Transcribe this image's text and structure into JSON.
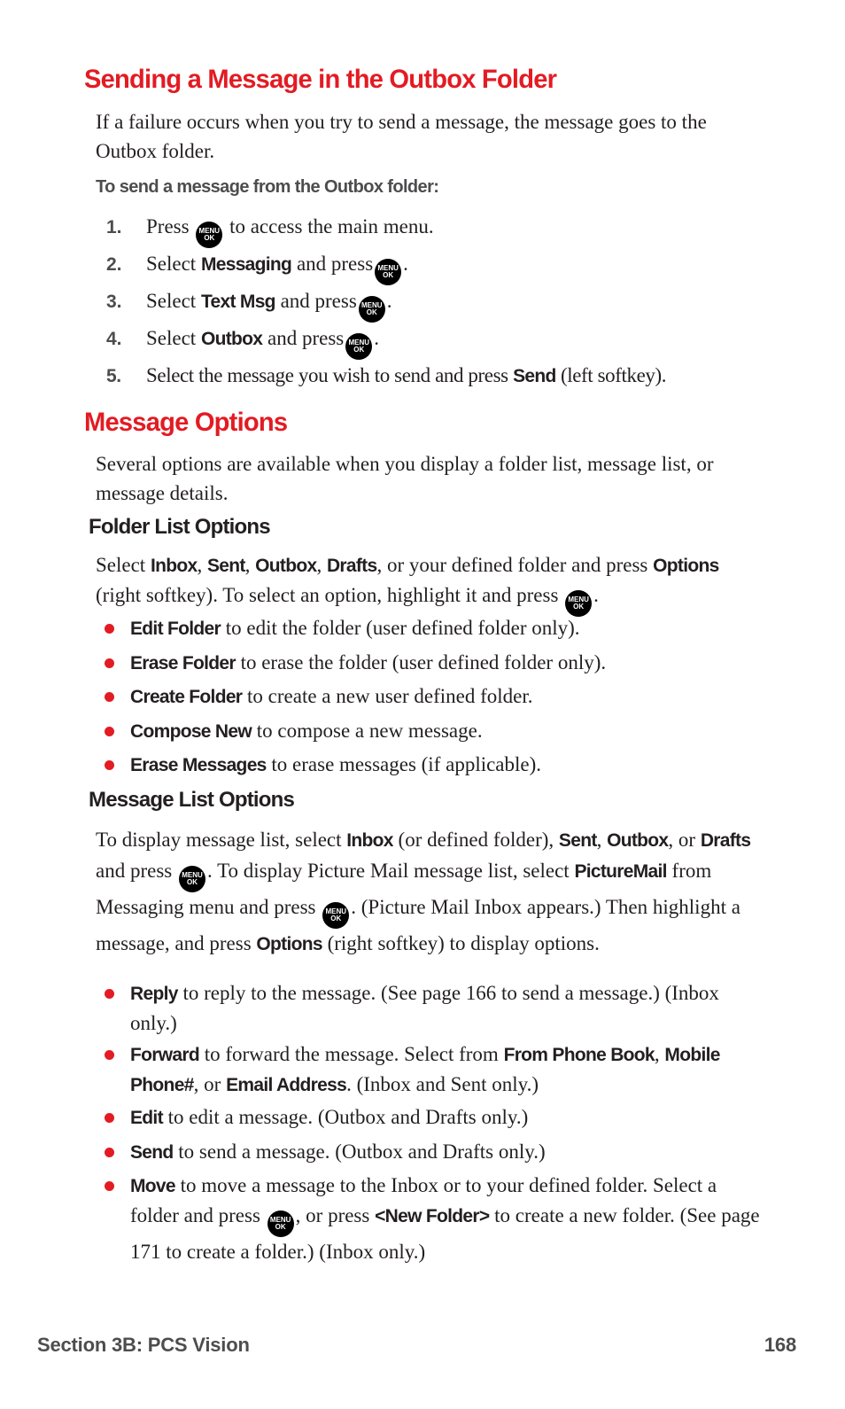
{
  "section1": {
    "title": "Sending a Message in the Outbox Folder",
    "intro": "If a failure occurs when you try to send a message, the message goes to the Outbox folder.",
    "subheading": "To send a message from the Outbox folder:",
    "steps": [
      {
        "num": "1.",
        "pre": "Press",
        "bold": "",
        "post": "to access the main menu."
      },
      {
        "num": "2.",
        "pre": "Select",
        "bold": "Messaging",
        "post": "and press"
      },
      {
        "num": "3.",
        "pre": "Select",
        "bold": "Text Msg",
        "post": "and press"
      },
      {
        "num": "4.",
        "pre": "Select",
        "bold": "Outbox",
        "post": "and press"
      },
      {
        "num": "5.",
        "pre": "Select the message you wish to send and press",
        "bold": "Send",
        "post": "(left softkey)."
      }
    ]
  },
  "menu_key": {
    "icon": "menu-ok-key-icon",
    "line1": "MENU",
    "line2": "OK"
  },
  "section2": {
    "title": "Message Options",
    "intro": "Several options are available when you display a folder list, message list, or message details.",
    "folder_list": {
      "heading": "Folder List Options",
      "intro": {
        "t1": "Select ",
        "b1": "Inbox",
        "t2": ", ",
        "b2": "Sent",
        "t3": ", ",
        "b3": "Outbox",
        "t4": ", ",
        "b4": "Drafts",
        "t5": ", or your defined folder and press ",
        "b5": "Options",
        "t6": " (right softkey). To select an option, highlight it and press ",
        "t7": "."
      },
      "items": [
        {
          "bold": "Edit Folder",
          "text": " to edit the folder (user defined folder only)."
        },
        {
          "bold": "Erase Folder",
          "text": " to erase the folder (user defined folder only)."
        },
        {
          "bold": "Create Folder",
          "text": " to create a new user defined folder."
        },
        {
          "bold": "Compose New",
          "text": " to compose a new message."
        },
        {
          "bold": "Erase Messages",
          "text": " to erase messages (if applicable)."
        }
      ]
    },
    "message_list": {
      "heading": "Message List Options",
      "intro": {
        "t1": "To display message list, select ",
        "b1": "Inbox",
        "t2": " (or defined folder), ",
        "b2": "Sent",
        "t3": ", ",
        "b3": "Outbox",
        "t4": ", or ",
        "b4": "Drafts",
        "t5": " and press ",
        "t6": ". To display Picture Mail message list, select ",
        "b5": "PictureMail",
        "t7": " from Messaging menu and press ",
        "t8": ". (Picture Mail Inbox appears.) Then highlight a message, and press ",
        "b6": "Options",
        "t9": " (right softkey) to display options."
      },
      "items": {
        "reply": {
          "bold": "Reply",
          "text": " to reply to the message. (See page 166 to send a message.) (Inbox only.)"
        },
        "forward": {
          "bold": "Forward",
          "t1": " to forward the message. Select from ",
          "b1": "From Phone Book",
          "t2": ", ",
          "b2": "Mobile Phone#",
          "t3": ", or ",
          "b3": "Email Address",
          "t4": ". (Inbox and Sent only.)"
        },
        "edit": {
          "bold": "Edit",
          "text": " to edit a message. (Outbox and Drafts only.)"
        },
        "send": {
          "bold": "Send",
          "text": " to send a message. (Outbox and Drafts only.)"
        },
        "move": {
          "bold": "Move",
          "t1": " to move a message to the Inbox or to your defined folder. Select a folder and press ",
          "t2": ", or press ",
          "b1": "<New Folder>",
          "t3": " to create a new folder. (See page 171 to create a folder.) (Inbox only.)"
        }
      }
    }
  },
  "footer": {
    "section": "Section 3B: PCS Vision",
    "page": "168"
  },
  "colors": {
    "accent_red": "#e31b23",
    "text": "#231f20",
    "gray": "#4d4d4f"
  }
}
